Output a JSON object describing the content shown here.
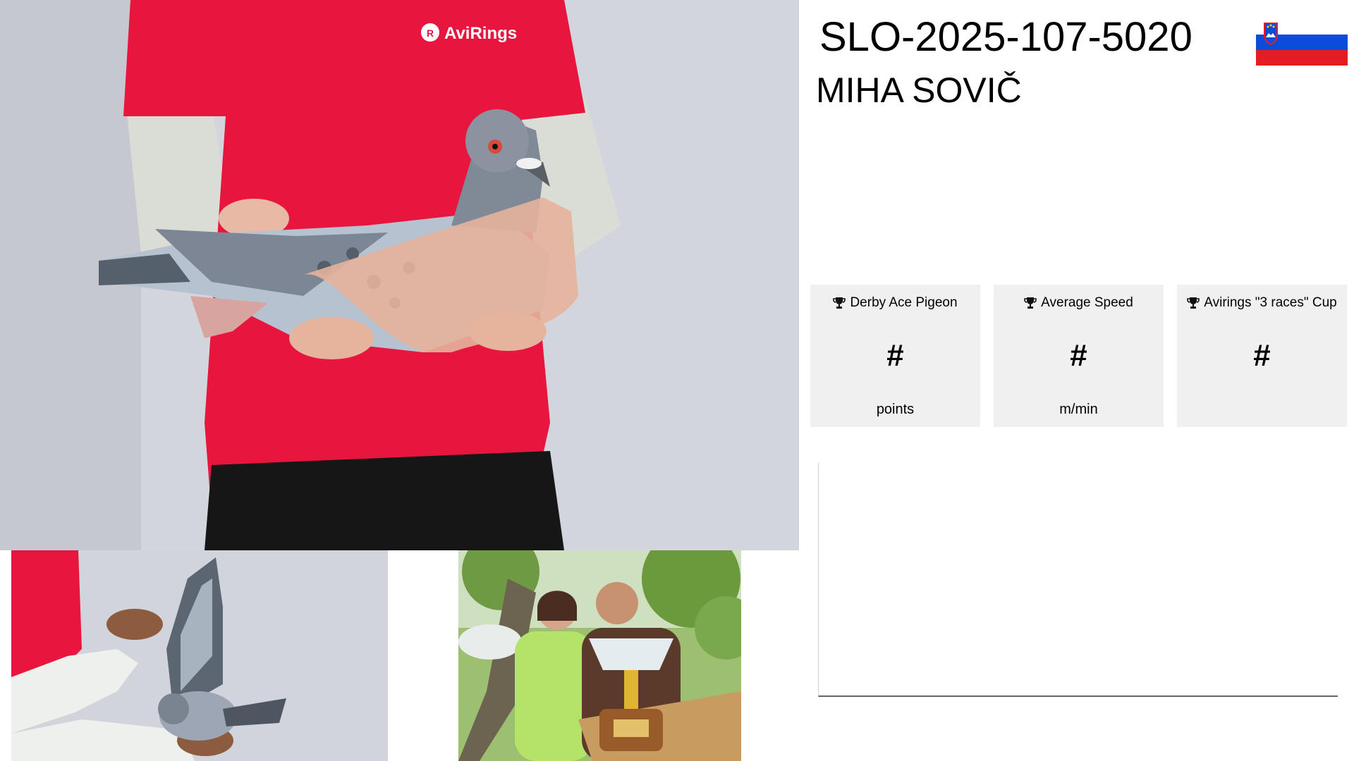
{
  "header": {
    "ring_number": "SLO-2025-107-5020",
    "owner_name": "MIHA SOVIČ"
  },
  "flag": {
    "country": "Slovenia",
    "colors": [
      "#ffffff",
      "#0b4cdb",
      "#e41c23"
    ]
  },
  "main_photo": {
    "shirt_logo_text": "AviRings"
  },
  "stats": [
    {
      "title": "Derby Ace Pigeon",
      "value": "#",
      "unit": "points",
      "icon": "trophy-icon"
    },
    {
      "title": "Average Speed",
      "value": "#",
      "unit": "m/min",
      "icon": "trophy-icon"
    },
    {
      "title": "Avirings \"3 races\" Cup",
      "value": "#",
      "unit": "",
      "icon": "trophy-icon"
    }
  ],
  "colors": {
    "shirt_red": "#e8163f",
    "card_bg": "#f0f0f0"
  }
}
